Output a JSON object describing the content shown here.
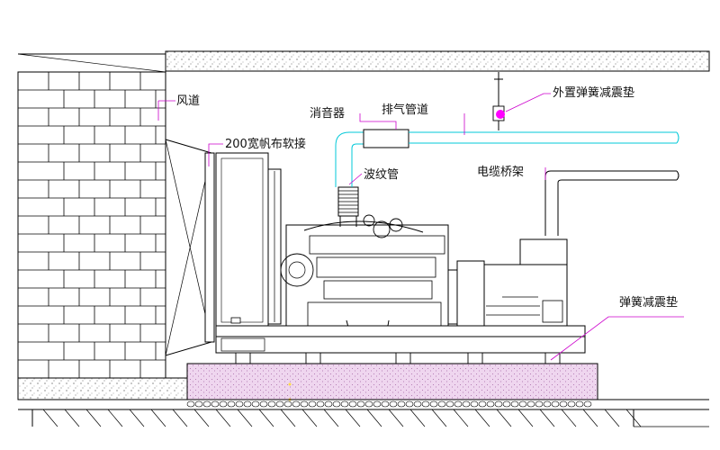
{
  "labels": {
    "air_duct": "风道",
    "canvas_joint": "200宽帆布软接",
    "muffler": "消音器",
    "exhaust_pipe": "排气管道",
    "bellows": "波纹管",
    "ext_spring_pad": "外置弹簧减震垫",
    "cable_tray": "电缆桥架",
    "spring_pad": "弹簧减震垫"
  },
  "colors": {
    "line": "#000000",
    "pipe": "#00c8d8",
    "leader": "#cc00cc",
    "accent": "#ff00ff",
    "foundation_fill": "#d8a8d8"
  }
}
